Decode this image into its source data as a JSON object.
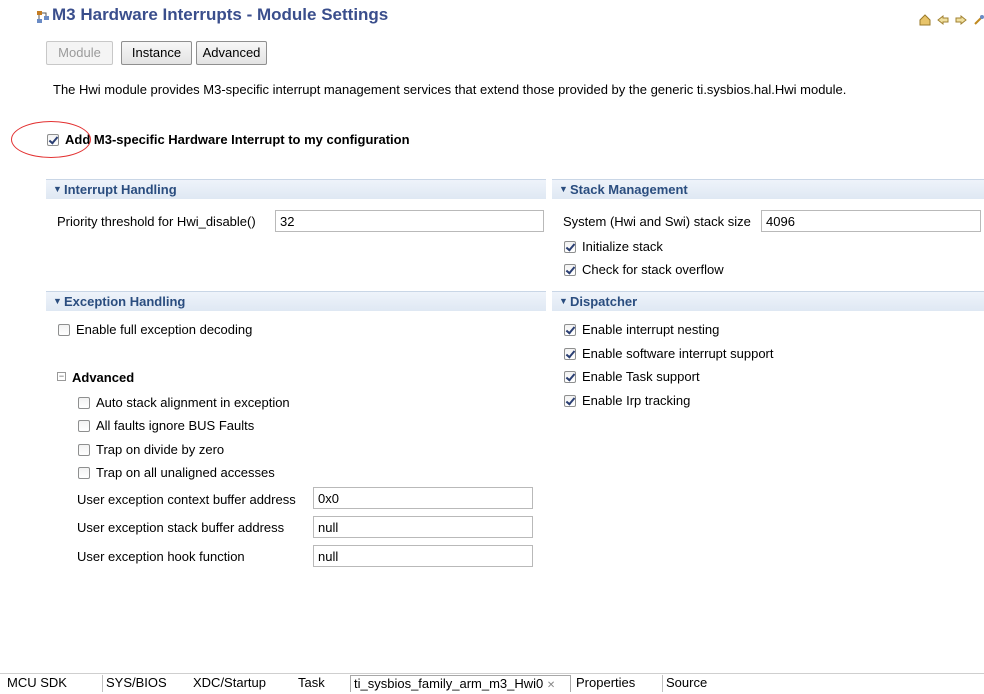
{
  "header": {
    "title": "M3 Hardware Interrupts - Module Settings",
    "toolbar_icons": [
      "home-icon",
      "back-icon",
      "forward-icon",
      "link-icon",
      "help-icon"
    ]
  },
  "tabs": {
    "module": "Module",
    "instance": "Instance",
    "advanced": "Advanced"
  },
  "description": "The Hwi module provides M3-specific interrupt management services that extend those provided by the generic ti.sysbios.hal.Hwi module.",
  "enable_checkbox": {
    "label": "Add M3-specific Hardware Interrupt to my configuration",
    "checked": true
  },
  "interrupt_handling": {
    "title": "Interrupt Handling",
    "priority_label": "Priority threshold for Hwi_disable()",
    "priority_value": "32"
  },
  "stack_management": {
    "title": "Stack Management",
    "stack_size_label": "System (Hwi and Swi) stack size",
    "stack_size_value": "4096",
    "initialize_stack": "Initialize stack",
    "check_overflow": "Check for stack overflow"
  },
  "exception_handling": {
    "title": "Exception Handling",
    "full_decoding": "Enable full exception decoding",
    "advanced_title": "Advanced",
    "auto_stack": "Auto stack alignment in exception",
    "all_faults": "All faults ignore BUS Faults",
    "trap_divide": "Trap on divide by zero",
    "trap_unaligned": "Trap on all unaligned accesses",
    "ctx_buffer_label": "User exception context buffer address",
    "ctx_buffer_value": "0x0",
    "stack_buffer_label": "User exception stack buffer address",
    "stack_buffer_value": "null",
    "hook_label": "User exception hook function",
    "hook_value": "null"
  },
  "dispatcher": {
    "title": "Dispatcher",
    "nesting": "Enable interrupt nesting",
    "swi_support": "Enable software interrupt support",
    "task_support": "Enable Task support",
    "irp_tracking": "Enable Irp tracking"
  },
  "bottom_tabs": [
    "MCU SDK",
    "SYS/BIOS",
    "XDC/Startup",
    "Task",
    "ti_sysbios_family_arm_m3_Hwi0",
    "Properties",
    "Source"
  ],
  "active_tab_close": "✕",
  "colors": {
    "title": "#3a4e8c",
    "section_header_text": "#2a4d7f",
    "annotation_circle": "#e33232"
  }
}
